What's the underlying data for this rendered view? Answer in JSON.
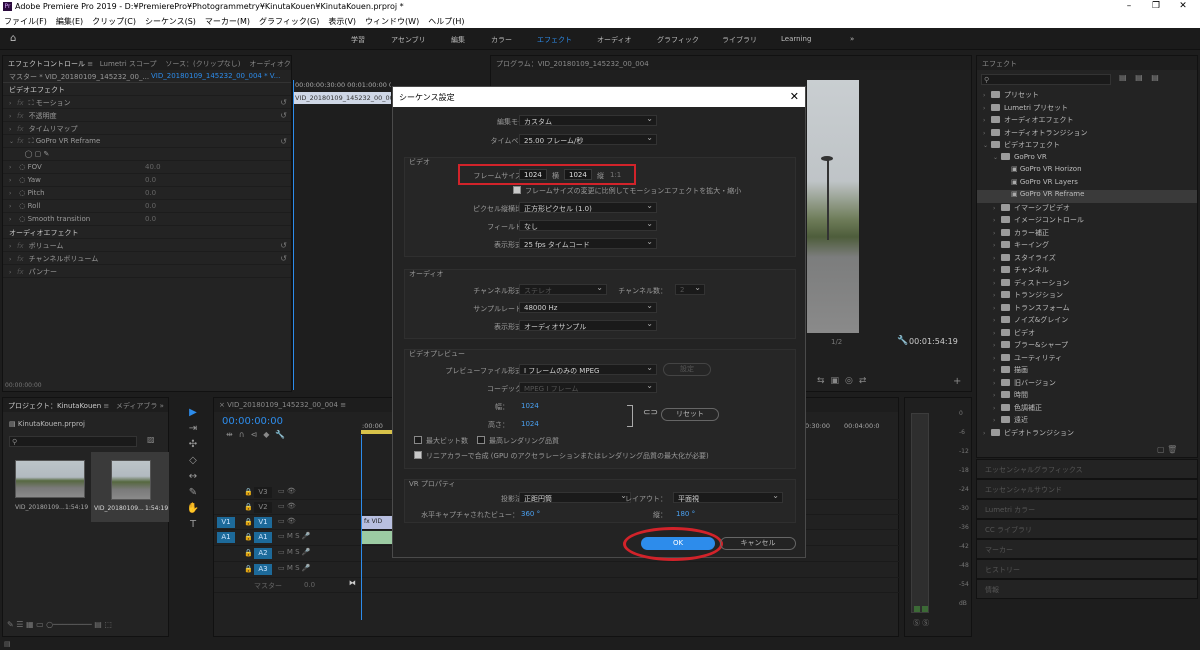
{
  "window": {
    "title": "Adobe Premiere Pro 2019 - D:¥PremierePro¥Photogrammetry¥KinutaKouen¥KinutaKouen.prproj *",
    "app_icon": "Pr"
  },
  "menu": [
    "ファイル(F)",
    "編集(E)",
    "クリップ(C)",
    "シーケンス(S)",
    "マーカー(M)",
    "グラフィック(G)",
    "表示(V)",
    "ウィンドウ(W)",
    "ヘルプ(H)"
  ],
  "workspaces": [
    "学習",
    "アセンブリ",
    "編集",
    "カラー",
    "エフェクト",
    "オーディオ",
    "グラフィック",
    "ライブラリ",
    "Learning"
  ],
  "effect_controls": {
    "tabs": [
      "エフェクトコントロール",
      "Lumetri スコープ",
      "ソース：(クリップなし)",
      "オーディオクリップミキサー"
    ],
    "master": "マスター * VID_20180109_145232_00_...",
    "clip": "VID_20180109_145232_00_004 * V...",
    "timecode": "00:00",
    "ruler_times": "00:00:00:30:00 00:01:00:00 00:01:30:00 00",
    "clip_bar": "VID_20180109_145232_00_004",
    "video_header": "ビデオエフェクト",
    "video_rows": [
      "モーション",
      "不透明度",
      "タイムリマップ",
      "GoPro VR Reframe"
    ],
    "params": [
      {
        "name": "FOV",
        "value": "40.0"
      },
      {
        "name": "Yaw",
        "value": "0.0"
      },
      {
        "name": "Pitch",
        "value": "0.0"
      },
      {
        "name": "Roll",
        "value": "0.0"
      },
      {
        "name": "Smooth transition",
        "value": "0.0"
      }
    ],
    "audio_header": "オーディオエフェクト",
    "audio_rows": [
      "ボリューム",
      "チャンネルボリューム",
      "パンナー"
    ],
    "bottom_time": "00:00:00:00"
  },
  "program": {
    "title": "プログラム：VID_20180109_145232_00_004",
    "fit": "1/2",
    "duration": "00:01:54:19"
  },
  "project": {
    "tabs": [
      "プロジェクト：KinutaKouen",
      "メディアブラ"
    ],
    "file": "KinutaKouen.prproj",
    "items": [
      {
        "name": "VID_20180109...",
        "dur": "1:54:19"
      },
      {
        "name": "VID_20180109...",
        "dur": "1:54:19"
      }
    ]
  },
  "timeline": {
    "tab": "VID_20180109_145232_00_004",
    "timecode": "00:00:00:00",
    "ruler_right": [
      "0:30:00",
      "00:04:00:0"
    ],
    "ruler_left": ":00:00",
    "tracks": [
      "V3",
      "V2",
      "V1",
      "A1",
      "A2",
      "A3"
    ],
    "master_label": "マスター",
    "master_value": "0.0",
    "clip_v": "fx VID",
    "meter_scale": [
      "0",
      "-6",
      "-12",
      "-18",
      "-24",
      "-30",
      "-36",
      "-42",
      "-48",
      "-54",
      "dB"
    ]
  },
  "effects_panel": {
    "title": "エフェクト",
    "search_placeholder": "",
    "items": [
      {
        "label": "プリセット",
        "level": 0,
        "open": false
      },
      {
        "label": "Lumetri プリセット",
        "level": 0,
        "open": false
      },
      {
        "label": "オーディオエフェクト",
        "level": 0,
        "open": false
      },
      {
        "label": "オーディオトランジション",
        "level": 0,
        "open": false
      },
      {
        "label": "ビデオエフェクト",
        "level": 0,
        "open": true
      },
      {
        "label": "GoPro VR",
        "level": 1,
        "open": true
      },
      {
        "label": "GoPro VR Horizon",
        "level": 2,
        "open": false
      },
      {
        "label": "GoPro VR Layers",
        "level": 2,
        "open": false
      },
      {
        "label": "GoPro VR Reframe",
        "level": 2,
        "open": false
      },
      {
        "label": "イマーシブビデオ",
        "level": 1,
        "open": false
      },
      {
        "label": "イメージコントロール",
        "level": 1,
        "open": false
      },
      {
        "label": "カラー補正",
        "level": 1,
        "open": false
      },
      {
        "label": "キーイング",
        "level": 1,
        "open": false
      },
      {
        "label": "スタイライズ",
        "level": 1,
        "open": false
      },
      {
        "label": "チャンネル",
        "level": 1,
        "open": false
      },
      {
        "label": "ディストーション",
        "level": 1,
        "open": false
      },
      {
        "label": "トランジション",
        "level": 1,
        "open": false
      },
      {
        "label": "トランスフォーム",
        "level": 1,
        "open": false
      },
      {
        "label": "ノイズ&グレイン",
        "level": 1,
        "open": false
      },
      {
        "label": "ビデオ",
        "level": 1,
        "open": false
      },
      {
        "label": "ブラー&シャープ",
        "level": 1,
        "open": false
      },
      {
        "label": "ユーティリティ",
        "level": 1,
        "open": false
      },
      {
        "label": "描画",
        "level": 1,
        "open": false
      },
      {
        "label": "旧バージョン",
        "level": 1,
        "open": false
      },
      {
        "label": "時間",
        "level": 1,
        "open": false
      },
      {
        "label": "色調補正",
        "level": 1,
        "open": false
      },
      {
        "label": "遠近",
        "level": 1,
        "open": false
      },
      {
        "label": "ビデオトランジション",
        "level": 0,
        "open": false
      }
    ],
    "collapsed_panels": [
      "エッセンシャルグラフィックス",
      "エッセンシャルサウンド",
      "Lumetri カラー",
      "CC ライブラリ",
      "マーカー",
      "ヒストリー",
      "情報"
    ]
  },
  "dialog": {
    "title": "シーケンス設定",
    "edit_mode_label": "編集モード：",
    "edit_mode": "カスタム",
    "timebase_label": "タイムベース：",
    "timebase": "25.00  フレーム/秒",
    "video_section": "ビデオ",
    "frame_size_label": "フレームサイズ：",
    "frame_w": "1024",
    "horiz_label": "横",
    "frame_h": "1024",
    "vert_label": "縦",
    "aspect": "1:1",
    "scale_check": "フレームサイズの変更に比例してモーションエフェクトを拡大・縮小",
    "pixel_aspect_label": "ピクセル縦横比：",
    "pixel_aspect": "正方形ピクセル (1.0)",
    "field_label": "フィールド：",
    "field": "なし",
    "display_label": "表示形式：",
    "display": "25 fps タイムコード",
    "audio_section": "オーディオ",
    "channel_format_label": "チャンネル形式：",
    "channel_format": "ステレオ",
    "channel_count_label": "チャンネル数：",
    "channel_count": "2",
    "sample_rate_label": "サンプルレート：",
    "sample_rate": "48000 Hz",
    "audio_display_label": "表示形式：",
    "audio_display": "オーディオサンプル",
    "preview_section": "ビデオプレビュー",
    "preview_format_label": "プレビューファイル形式：",
    "preview_format": "I フレームのみの MPEG",
    "preview_settings": "設定",
    "codec_label": "コーデック：",
    "codec": "MPEG I フレーム",
    "width_label": "幅：",
    "width": "1024",
    "height_label": "高さ：",
    "height": "1024",
    "reset_btn": "リセット",
    "max_bit": "最大ビット数",
    "max_render": "最高レンダリング品質",
    "linear_color": "リニアカラーで合成 (GPU のアクセラレーションまたはレンダリング品質の最大化が必要)",
    "vr_section": "VR プロパティ",
    "projection_label": "投影法：",
    "projection": "正距円筒",
    "layout_label": "レイアウト：",
    "layout": "平面視",
    "capture_label": "水平キャプチャされたビュー：",
    "capture_h": "360 °",
    "vert_view_label": "縦：",
    "capture_v": "180 °",
    "ok": "OK",
    "cancel": "キャンセル"
  }
}
